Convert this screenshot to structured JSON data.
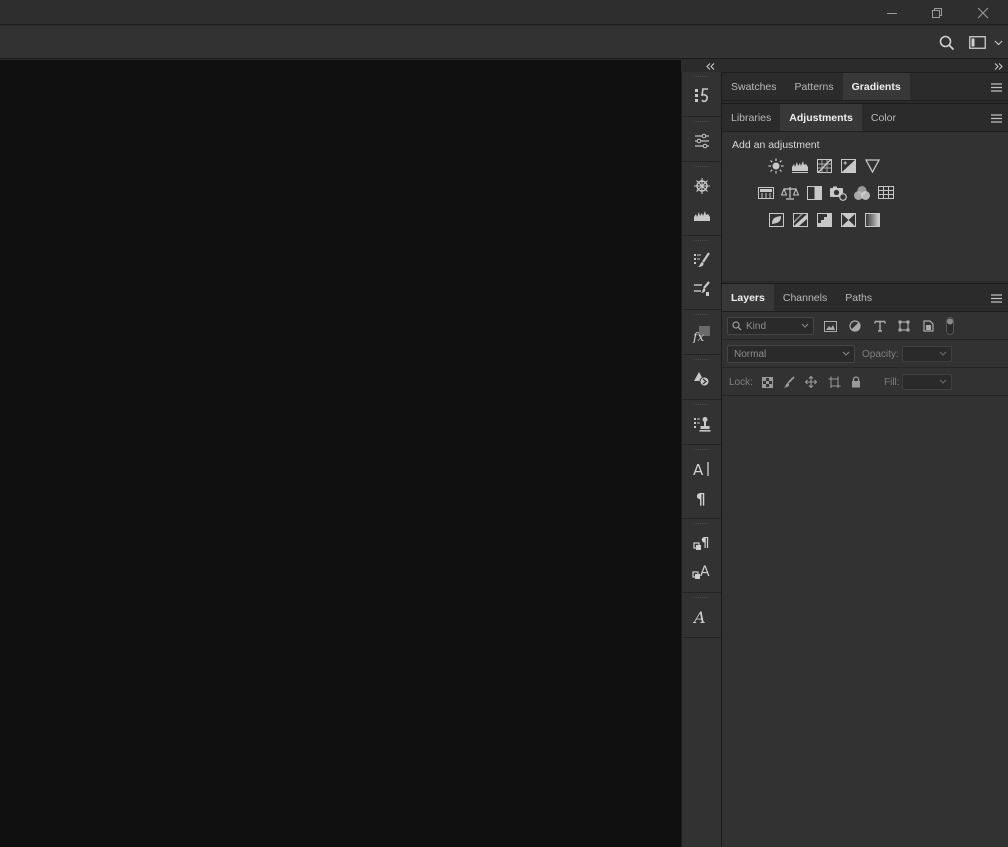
{
  "colors": {
    "canvas": "#101010",
    "panel": "#323232",
    "tab_active": "#383838",
    "icon": "#c8c8c8"
  },
  "window_controls": [
    "minimize-icon",
    "restore-icon",
    "close-icon"
  ],
  "options_bar": {
    "icons": [
      "search-icon",
      "workspace-icon",
      "chevron-down-icon"
    ]
  },
  "icon_column": {
    "groups": [
      [
        "history-icon"
      ],
      [
        "properties-icon"
      ],
      [
        "navigator-icon",
        "histogram-icon"
      ],
      [
        "brush-settings-icon",
        "brushes-icon"
      ],
      [
        "styles-icon"
      ],
      [
        "shapes-icon"
      ],
      [
        "clone-source-icon"
      ],
      [
        "character-icon",
        "paragraph-icon"
      ],
      [
        "paragraph-styles-icon",
        "character-styles-icon"
      ],
      [
        "glyphs-icon"
      ]
    ]
  },
  "top_panel": {
    "tabs": [
      "Swatches",
      "Patterns",
      "Gradients"
    ],
    "active": "Gradients"
  },
  "adjustments_panel": {
    "tabs": [
      "Libraries",
      "Adjustments",
      "Color"
    ],
    "active": "Adjustments",
    "title": "Add an adjustment",
    "rows": [
      [
        "brightness-contrast-icon",
        "levels-icon",
        "curves-icon",
        "exposure-icon",
        "vibrance-icon"
      ],
      [
        "hue-saturation-icon",
        "color-balance-icon",
        "black-white-icon",
        "photo-filter-icon",
        "channel-mixer-icon",
        "color-lookup-icon"
      ],
      [
        "invert-icon",
        "posterize-icon",
        "threshold-icon",
        "selective-color-icon",
        "gradient-map-icon"
      ]
    ]
  },
  "layers_panel": {
    "tabs": [
      "Layers",
      "Channels",
      "Paths"
    ],
    "active": "Layers",
    "kind_placeholder": "Kind",
    "filter_icons": [
      "pixel-filter-icon",
      "adjustment-filter-icon",
      "type-filter-icon",
      "shape-filter-icon",
      "smart-object-filter-icon",
      "filter-toggle-icon"
    ],
    "blend_mode": "Normal",
    "opacity_label": "Opacity:",
    "lock_label": "Lock:",
    "lock_icons": [
      "lock-transparent-icon",
      "lock-image-icon",
      "lock-position-icon",
      "lock-artboard-icon",
      "lock-all-icon"
    ],
    "fill_label": "Fill:"
  }
}
